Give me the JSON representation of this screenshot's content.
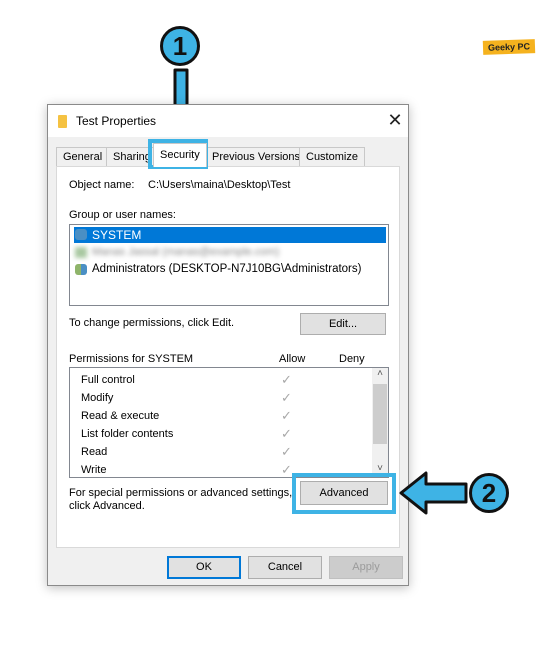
{
  "window": {
    "title": "Test Properties",
    "close_glyph": "✕"
  },
  "tabs": [
    {
      "label": "General",
      "active": false
    },
    {
      "label": "Sharing",
      "active": false
    },
    {
      "label": "Security",
      "active": true
    },
    {
      "label": "Previous Versions",
      "active": false
    },
    {
      "label": "Customize",
      "active": false
    }
  ],
  "security": {
    "object_name_label": "Object name:",
    "object_name_value": "C:\\Users\\maina\\Desktop\\Test",
    "group_label": "Group or user names:",
    "groups": [
      {
        "name": "SYSTEM",
        "selected": true
      },
      {
        "name": "Manas Jassal (manas@example.com)",
        "blurred": true
      },
      {
        "name": "Administrators (DESKTOP-N7J10BG\\Administrators)",
        "selected": false
      }
    ],
    "change_hint": "To change permissions, click Edit.",
    "edit_button": "Edit...",
    "permissions_label": "Permissions for SYSTEM",
    "allow_header": "Allow",
    "deny_header": "Deny",
    "permissions": [
      {
        "name": "Full control",
        "allow": "✓",
        "deny": ""
      },
      {
        "name": "Modify",
        "allow": "✓",
        "deny": ""
      },
      {
        "name": "Read & execute",
        "allow": "✓",
        "deny": ""
      },
      {
        "name": "List folder contents",
        "allow": "✓",
        "deny": ""
      },
      {
        "name": "Read",
        "allow": "✓",
        "deny": ""
      },
      {
        "name": "Write",
        "allow": "✓",
        "deny": ""
      }
    ],
    "advanced_hint_line1": "For special permissions or advanced settings,",
    "advanced_hint_line2": "click Advanced.",
    "advanced_button": "Advanced"
  },
  "footer": {
    "ok": "OK",
    "cancel": "Cancel",
    "apply": "Apply"
  },
  "scroll": {
    "up": "˄",
    "down": "˅"
  },
  "callouts": {
    "step1": "1",
    "step2": "2"
  },
  "logo": "Geeky PC",
  "colors": {
    "accent": "#3eb3e5",
    "selection": "#0078d7",
    "logo": "#f5b21e"
  }
}
